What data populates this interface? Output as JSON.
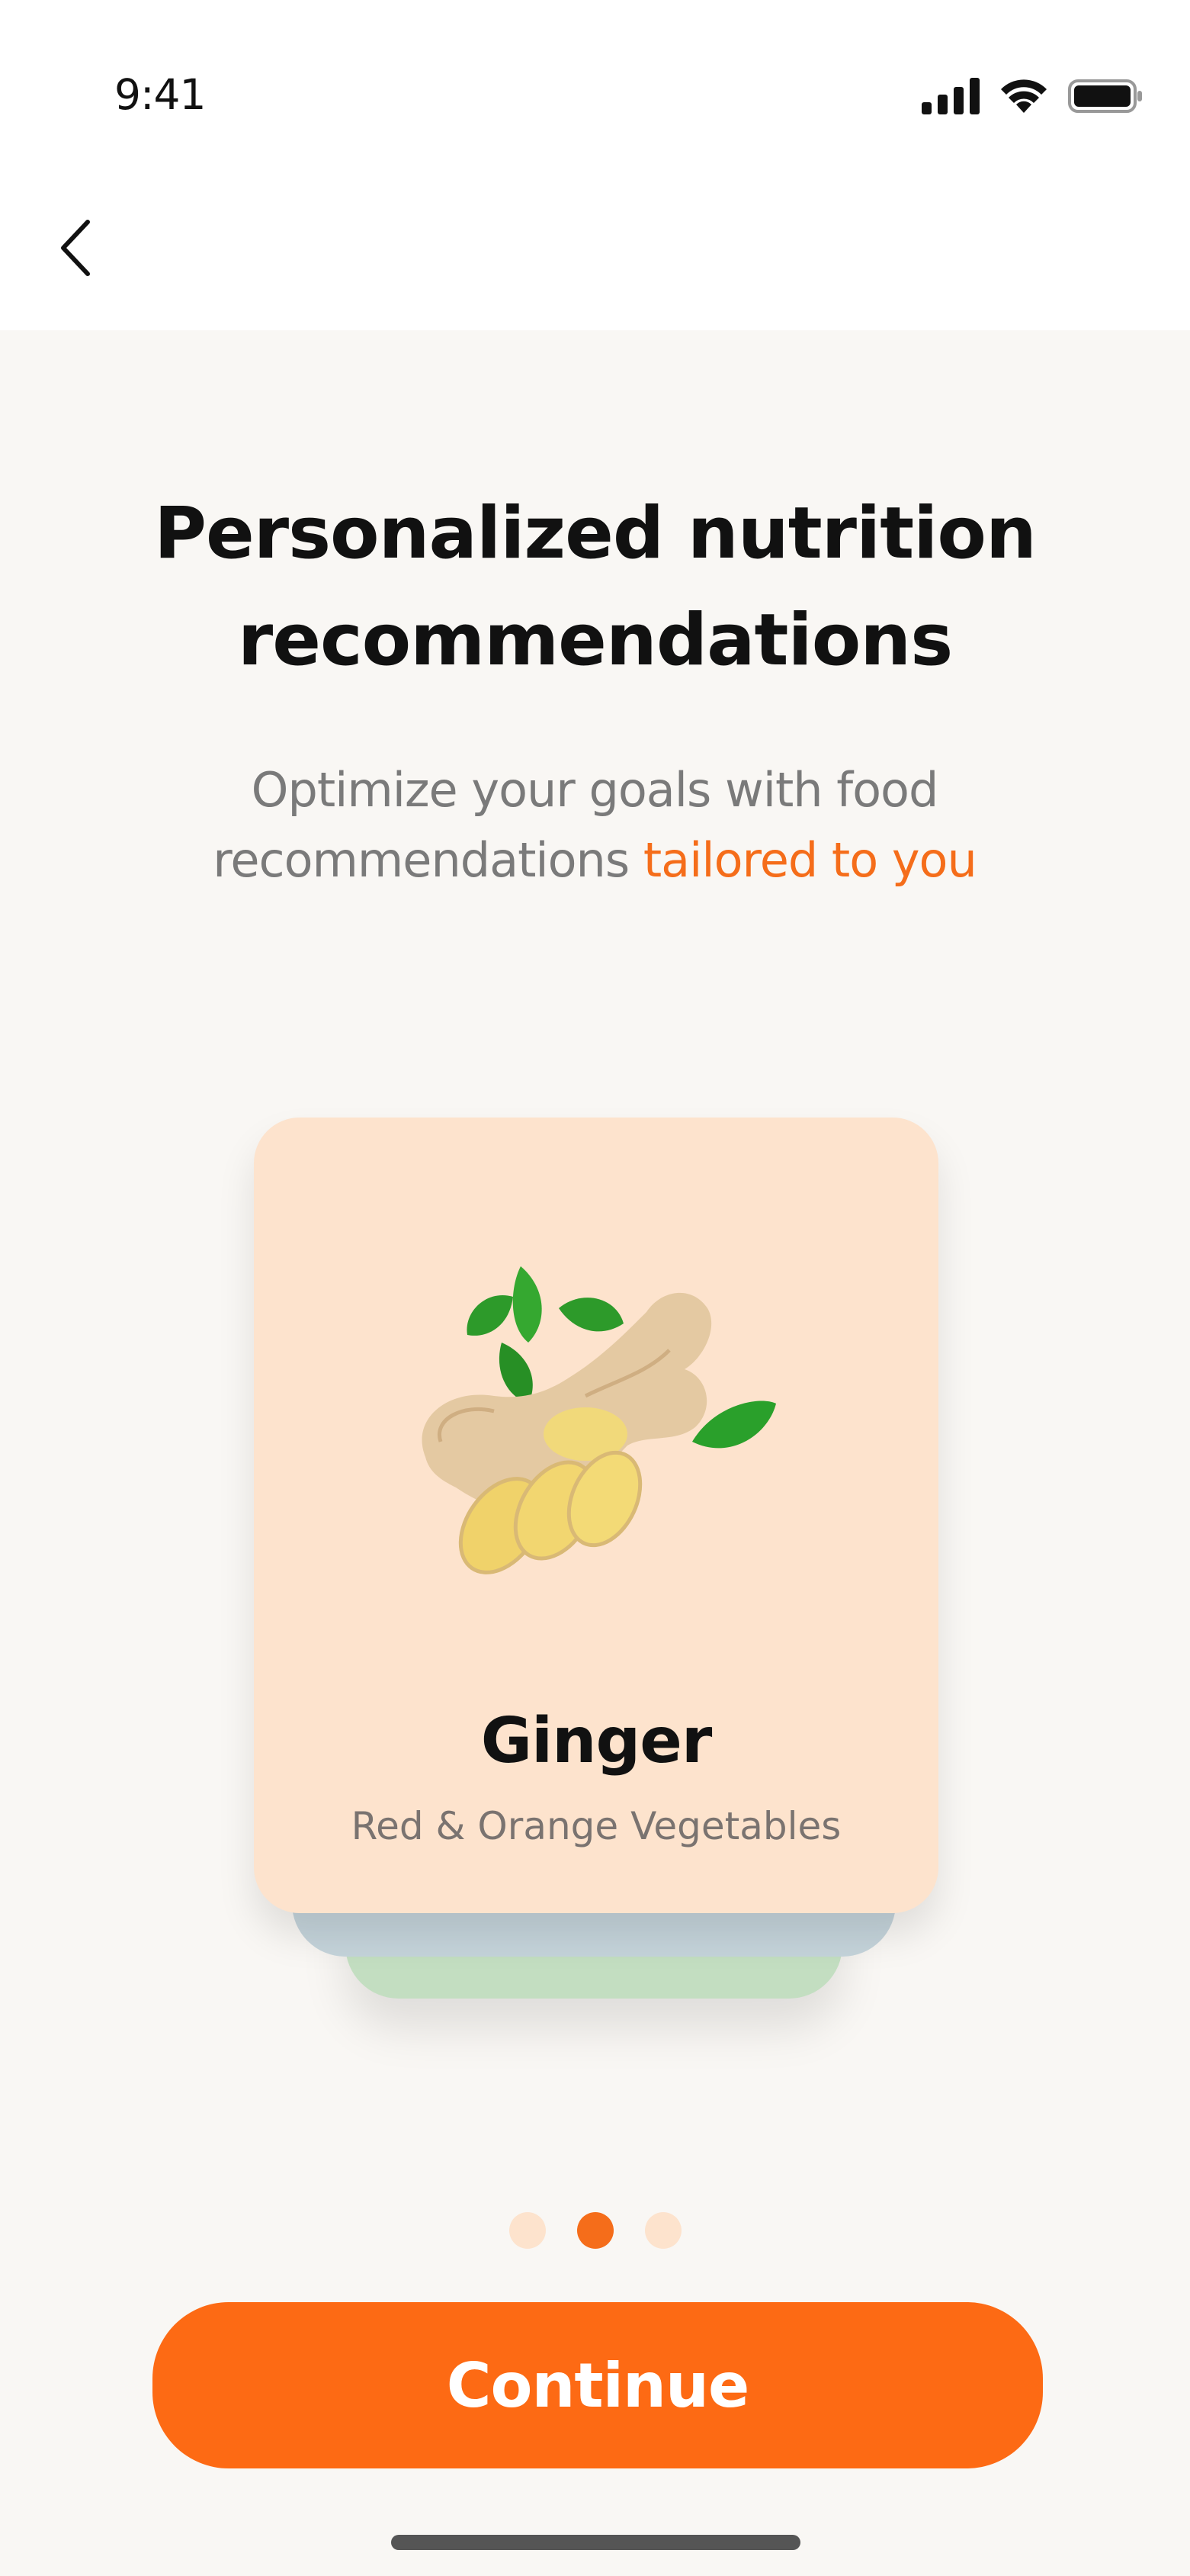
{
  "status_bar": {
    "time": "9:41"
  },
  "nav": {
    "back_icon": "chevron-left-icon"
  },
  "title": {
    "line1": "Personalized nutrition",
    "line2": "recommendations"
  },
  "subtitle": {
    "line1": "Optimize your goals with food",
    "line2_prefix": "recommendations ",
    "line2_accent": "tailored to you"
  },
  "card": {
    "name": "Ginger",
    "category": "Red & Orange Vegetables",
    "image_icon": "ginger-image"
  },
  "pagination": {
    "count": 3,
    "active_index": 1
  },
  "cta": {
    "label": "Continue"
  },
  "colors": {
    "accent": "#f56d1a",
    "button": "#fd6a14",
    "card_front": "#fde3cd",
    "card_back_blue": "#c5d4db",
    "card_back_green": "#c3dec1",
    "background": "#f9f7f4"
  }
}
